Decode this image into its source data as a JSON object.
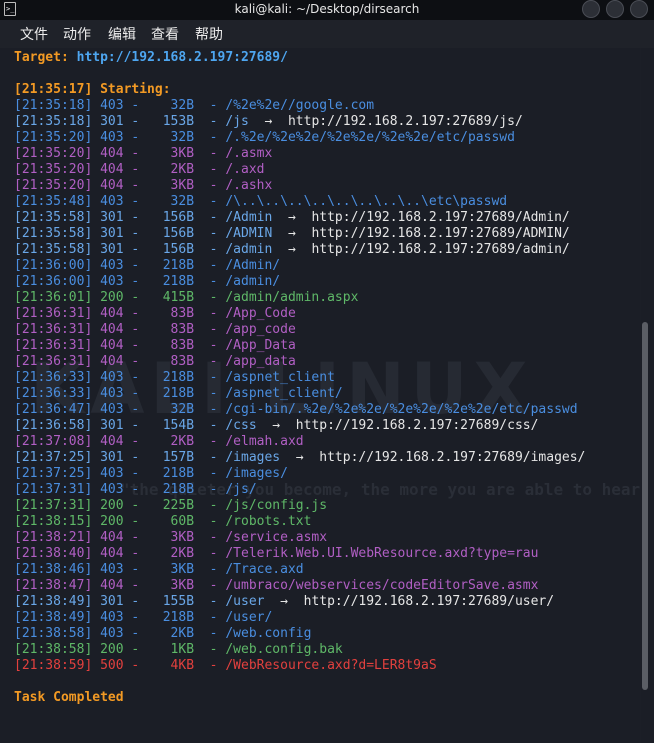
{
  "window": {
    "title": "kali@kali: ~/Desktop/dirsearch"
  },
  "menu": [
    "文件",
    "动作",
    "编辑",
    "查看",
    "帮助"
  ],
  "target": {
    "label": "Target:",
    "url": "http://192.168.2.197:27689/"
  },
  "starting": "[21:35:17] Starting:",
  "watermark": {
    "logo": "KALI LINUX",
    "quote": "\"the quieter you become, the more you are able to hear\""
  },
  "rows": [
    {
      "time": "[21:35:18]",
      "code": "403",
      "size": "32B",
      "path": "/%2e%2e//google.com",
      "redirect": ""
    },
    {
      "time": "[21:35:18]",
      "code": "301",
      "size": "153B",
      "path": "/js",
      "redirect": "http://192.168.2.197:27689/js/"
    },
    {
      "time": "[21:35:20]",
      "code": "403",
      "size": "32B",
      "path": "/.%2e/%2e%2e/%2e%2e/%2e%2e/etc/passwd",
      "redirect": ""
    },
    {
      "time": "[21:35:20]",
      "code": "404",
      "size": "3KB",
      "path": "/.asmx",
      "redirect": ""
    },
    {
      "time": "[21:35:20]",
      "code": "404",
      "size": "2KB",
      "path": "/.axd",
      "redirect": ""
    },
    {
      "time": "[21:35:20]",
      "code": "404",
      "size": "3KB",
      "path": "/.ashx",
      "redirect": ""
    },
    {
      "time": "[21:35:48]",
      "code": "403",
      "size": "32B",
      "path": "/\\..\\..\\..\\..\\..\\..\\..\\..\\etc\\passwd",
      "redirect": ""
    },
    {
      "time": "[21:35:58]",
      "code": "301",
      "size": "156B",
      "path": "/Admin",
      "redirect": "http://192.168.2.197:27689/Admin/"
    },
    {
      "time": "[21:35:58]",
      "code": "301",
      "size": "156B",
      "path": "/ADMIN",
      "redirect": "http://192.168.2.197:27689/ADMIN/"
    },
    {
      "time": "[21:35:58]",
      "code": "301",
      "size": "156B",
      "path": "/admin",
      "redirect": "http://192.168.2.197:27689/admin/"
    },
    {
      "time": "[21:36:00]",
      "code": "403",
      "size": "218B",
      "path": "/Admin/",
      "redirect": ""
    },
    {
      "time": "[21:36:00]",
      "code": "403",
      "size": "218B",
      "path": "/admin/",
      "redirect": ""
    },
    {
      "time": "[21:36:01]",
      "code": "200",
      "size": "415B",
      "path": "/admin/admin.aspx",
      "redirect": ""
    },
    {
      "time": "[21:36:31]",
      "code": "404",
      "size": "83B",
      "path": "/App_Code",
      "redirect": ""
    },
    {
      "time": "[21:36:31]",
      "code": "404",
      "size": "83B",
      "path": "/app_code",
      "redirect": ""
    },
    {
      "time": "[21:36:31]",
      "code": "404",
      "size": "83B",
      "path": "/App_Data",
      "redirect": ""
    },
    {
      "time": "[21:36:31]",
      "code": "404",
      "size": "83B",
      "path": "/app_data",
      "redirect": ""
    },
    {
      "time": "[21:36:33]",
      "code": "403",
      "size": "218B",
      "path": "/aspnet_client",
      "redirect": ""
    },
    {
      "time": "[21:36:33]",
      "code": "403",
      "size": "218B",
      "path": "/aspnet_client/",
      "redirect": ""
    },
    {
      "time": "[21:36:47]",
      "code": "403",
      "size": "32B",
      "path": "/cgi-bin/.%2e/%2e%2e/%2e%2e/%2e%2e/etc/passwd",
      "redirect": ""
    },
    {
      "time": "[21:36:58]",
      "code": "301",
      "size": "154B",
      "path": "/css",
      "redirect": "http://192.168.2.197:27689/css/"
    },
    {
      "time": "[21:37:08]",
      "code": "404",
      "size": "2KB",
      "path": "/elmah.axd",
      "redirect": ""
    },
    {
      "time": "[21:37:25]",
      "code": "301",
      "size": "157B",
      "path": "/images",
      "redirect": "http://192.168.2.197:27689/images/"
    },
    {
      "time": "[21:37:25]",
      "code": "403",
      "size": "218B",
      "path": "/images/",
      "redirect": ""
    },
    {
      "time": "[21:37:31]",
      "code": "403",
      "size": "218B",
      "path": "/js/",
      "redirect": ""
    },
    {
      "time": "[21:37:31]",
      "code": "200",
      "size": "225B",
      "path": "/js/config.js",
      "redirect": ""
    },
    {
      "time": "[21:38:15]",
      "code": "200",
      "size": "60B",
      "path": "/robots.txt",
      "redirect": ""
    },
    {
      "time": "[21:38:21]",
      "code": "404",
      "size": "3KB",
      "path": "/service.asmx",
      "redirect": ""
    },
    {
      "time": "[21:38:40]",
      "code": "404",
      "size": "2KB",
      "path": "/Telerik.Web.UI.WebResource.axd?type=rau",
      "redirect": ""
    },
    {
      "time": "[21:38:46]",
      "code": "403",
      "size": "3KB",
      "path": "/Trace.axd",
      "redirect": ""
    },
    {
      "time": "[21:38:47]",
      "code": "404",
      "size": "3KB",
      "path": "/umbraco/webservices/codeEditorSave.asmx",
      "redirect": ""
    },
    {
      "time": "[21:38:49]",
      "code": "301",
      "size": "155B",
      "path": "/user",
      "redirect": "http://192.168.2.197:27689/user/"
    },
    {
      "time": "[21:38:49]",
      "code": "403",
      "size": "218B",
      "path": "/user/",
      "redirect": ""
    },
    {
      "time": "[21:38:58]",
      "code": "403",
      "size": "2KB",
      "path": "/web.config",
      "redirect": ""
    },
    {
      "time": "[21:38:58]",
      "code": "200",
      "size": "1KB",
      "path": "/web.config.bak",
      "redirect": ""
    },
    {
      "time": "[21:38:59]",
      "code": "500",
      "size": "4KB",
      "path": "/WebResource.axd?d=LER8t9aS",
      "redirect": ""
    }
  ],
  "completed": "Task Completed",
  "colors": {
    "orange": "#f39a24",
    "blue": "#4ea6f0",
    "403": "#4a8ee0",
    "404": "#b15fc4",
    "200": "#5fb868",
    "500": "#e2403e"
  }
}
